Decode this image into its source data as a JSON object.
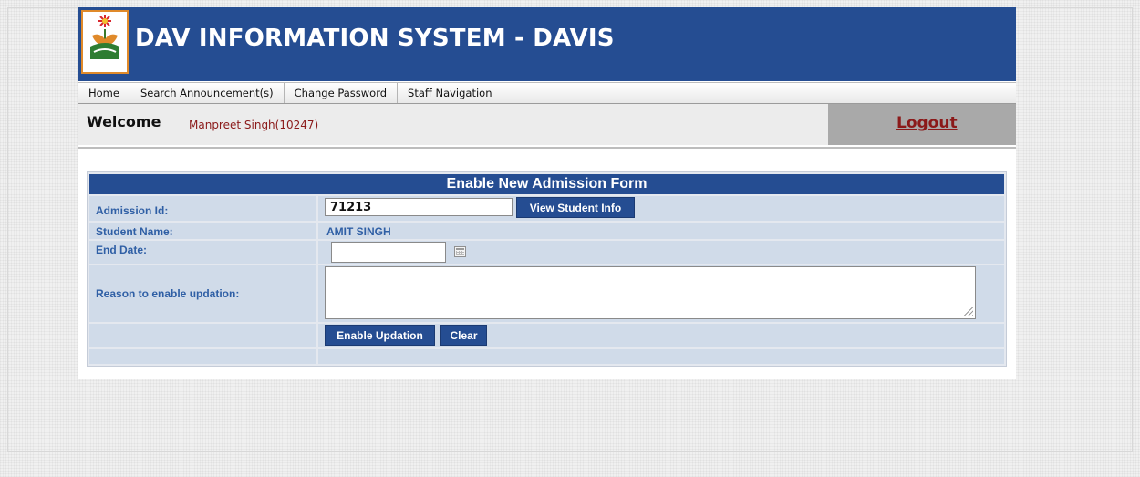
{
  "app": {
    "title": "DAV INFORMATION SYSTEM - DAVIS",
    "logo_text": "DAV UNIVERSITY"
  },
  "menu": {
    "items": [
      {
        "label": "Home"
      },
      {
        "label": "Search Announcement(s)"
      },
      {
        "label": "Change Password"
      },
      {
        "label": "Staff Navigation"
      }
    ]
  },
  "welcome": {
    "label": "Welcome",
    "user": "Manpreet Singh(10247)",
    "logout_label": "Logout"
  },
  "form": {
    "title": "Enable New Admission Form",
    "admission_id_label": "Admission Id:",
    "admission_id_value": "71213",
    "view_button": "View Student Info",
    "student_name_label": "Student Name:",
    "student_name_value": "AMIT SINGH",
    "end_date_label": "End Date:",
    "end_date_value": "",
    "reason_label": "Reason to enable updation:",
    "reason_value": "",
    "enable_button": "Enable Updation",
    "clear_button": "Clear"
  },
  "colors": {
    "banner": "#254d92",
    "accent_text": "#2f5fa5",
    "user_text": "#8b1a1a",
    "logout_bg": "#a9a9a9",
    "form_cell": "#d0dbe9"
  },
  "icons": {
    "calendar": "calendar-icon",
    "logo": "university-logo"
  }
}
